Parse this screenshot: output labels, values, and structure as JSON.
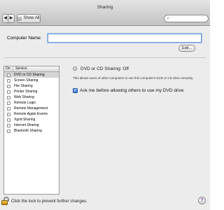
{
  "window": {
    "title": "Sharing"
  },
  "toolbar": {
    "back": "◀",
    "forward": "▶",
    "show_all": "Show All",
    "search_icon": "magnifier-icon"
  },
  "computer": {
    "label": "Computer Name:",
    "value": "",
    "note": "",
    "edit_label": "Edit..."
  },
  "services": {
    "header_on": "On",
    "header_service": "Service",
    "items": [
      {
        "label": "DVD or CD Sharing",
        "on": false,
        "selected": true
      },
      {
        "label": "Screen Sharing",
        "on": false
      },
      {
        "label": "File Sharing",
        "on": false
      },
      {
        "label": "Printer Sharing",
        "on": false
      },
      {
        "label": "Web Sharing",
        "on": false
      },
      {
        "label": "Remote Login",
        "on": false
      },
      {
        "label": "Remote Management",
        "on": false
      },
      {
        "label": "Remote Apple Events",
        "on": false
      },
      {
        "label": "Xgrid Sharing",
        "on": false
      },
      {
        "label": "Internet Sharing",
        "on": false
      },
      {
        "label": "Bluetooth Sharing",
        "on": false
      }
    ]
  },
  "detail": {
    "status": "DVD or CD Sharing: Off",
    "description": "This allows users of other computers to use this computer's DVD or CD drive remotely.",
    "ask_label": "Ask me before allowing others to use my DVD drive",
    "ask_checked": true
  },
  "footer": {
    "lock_text": "Click the lock to prevent further changes.",
    "help": "?"
  }
}
